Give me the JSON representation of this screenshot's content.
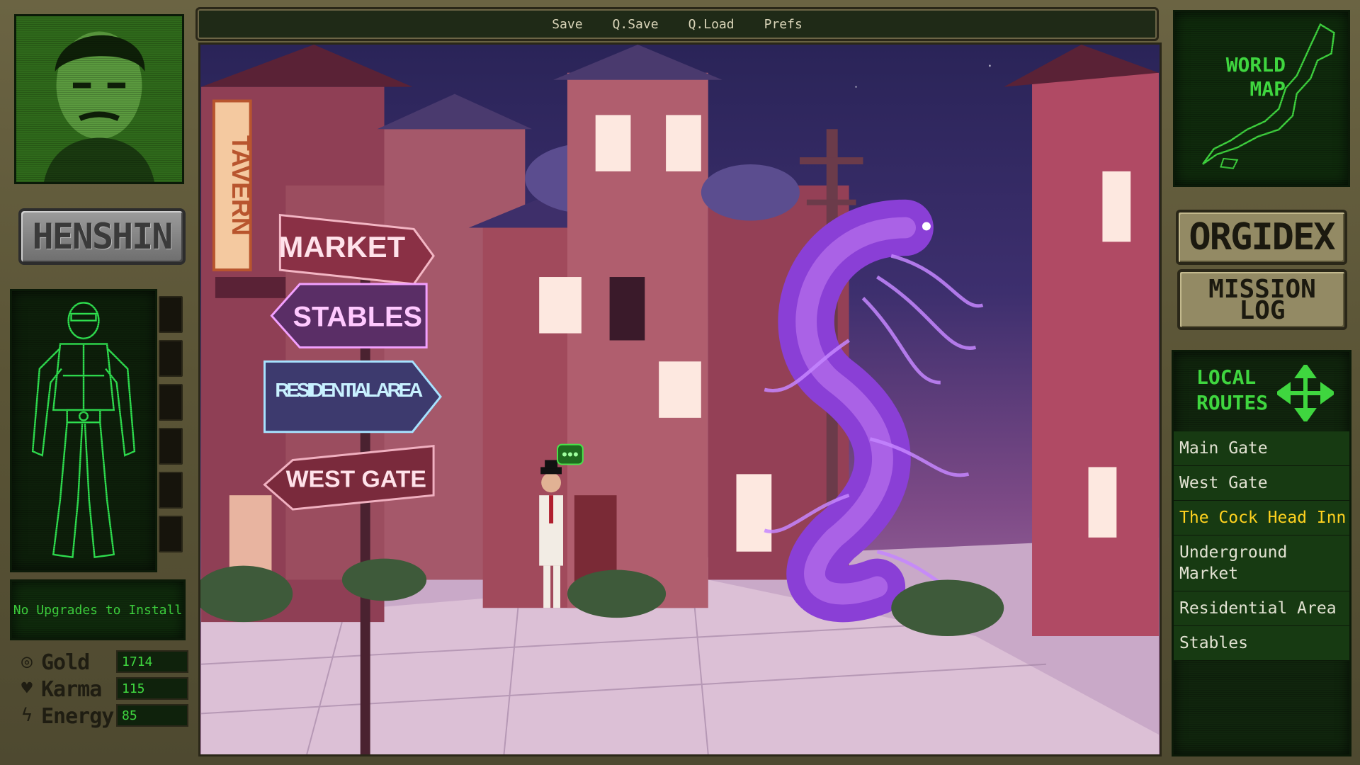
{
  "menu": {
    "items": [
      "Save",
      "Q.Save",
      "Q.Load",
      "Prefs"
    ]
  },
  "left_panel": {
    "henshin_label": "HENSHIN",
    "upgrade_text": "No Upgrades to Install",
    "stats": [
      {
        "icon": "coin-icon",
        "label": "Gold",
        "value": "1714"
      },
      {
        "icon": "heart-icon",
        "label": "Karma",
        "value": "115"
      },
      {
        "icon": "lightning-icon",
        "label": "Energy",
        "value": "85"
      }
    ]
  },
  "right_panel": {
    "world_map_label": "WORLD MAP",
    "world_map_line1": "WORLD",
    "world_map_line2": "MAP",
    "orgidex_label": "ORGIDEX",
    "mission_line1": "MISSION",
    "mission_line2": "LOG",
    "routes_line1": "LOCAL",
    "routes_line2": "ROUTES",
    "routes": [
      {
        "label": "Main Gate",
        "active": false
      },
      {
        "label": "West Gate",
        "active": false
      },
      {
        "label": "The Cock Head Inn",
        "active": true
      },
      {
        "label": "Underground Market",
        "active": false
      },
      {
        "label": "Residential Area",
        "active": false
      },
      {
        "label": "Stables",
        "active": false
      }
    ]
  },
  "scene": {
    "tavern_sign": "TAVERN",
    "signposts": [
      "MARKET",
      "STABLES",
      "RESIDENTIAL AREA",
      "WEST GATE"
    ],
    "colors": {
      "accent_green": "#3fd63f",
      "active_route": "#ffd21f",
      "frame": "#6b6443"
    }
  }
}
